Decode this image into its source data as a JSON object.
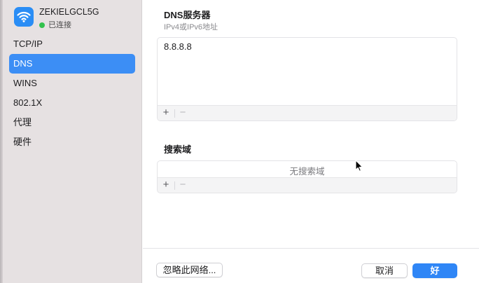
{
  "sidebar": {
    "network": {
      "name": "ZEKIELGCL5G",
      "status": "已连接",
      "icon": "wifi-icon",
      "status_color": "#32c24d"
    },
    "items": [
      {
        "label": "TCP/IP"
      },
      {
        "label": "DNS",
        "selected": true
      },
      {
        "label": "WINS"
      },
      {
        "label": "802.1X"
      },
      {
        "label": "代理"
      },
      {
        "label": "硬件"
      }
    ]
  },
  "dns": {
    "title": "DNS服务器",
    "subtitle": "IPv4或IPv6地址",
    "servers": [
      "8.8.8.8"
    ],
    "add_label": "+",
    "remove_label": "−"
  },
  "search_domains": {
    "title": "搜索域",
    "empty_text": "无搜索域",
    "add_label": "+",
    "remove_label": "−"
  },
  "footer": {
    "ignore_label": "忽略此网络...",
    "cancel_label": "取消",
    "ok_label": "好"
  },
  "colors": {
    "accent": "#2f86f6",
    "sidebar_bg": "#e6e1e2",
    "selected_bg": "#3c8ef5"
  }
}
